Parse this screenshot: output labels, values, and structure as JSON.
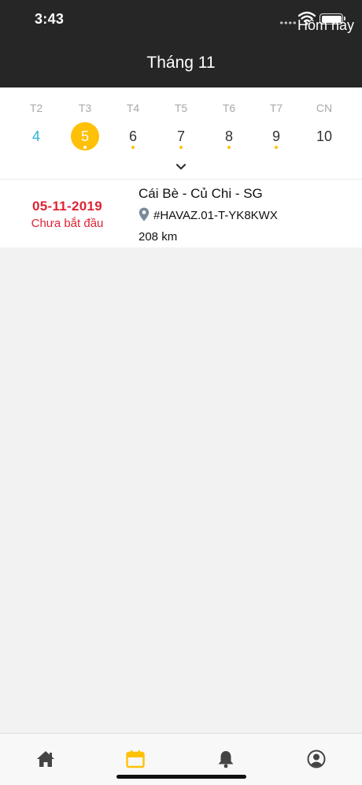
{
  "status_bar": {
    "time": "3:43"
  },
  "header": {
    "title": "Tháng 11",
    "today_label": "Hôm nay"
  },
  "calendar": {
    "days": [
      {
        "name": "T2",
        "date": "4"
      },
      {
        "name": "T3",
        "date": "5"
      },
      {
        "name": "T4",
        "date": "6"
      },
      {
        "name": "T5",
        "date": "7"
      },
      {
        "name": "T6",
        "date": "8"
      },
      {
        "name": "T7",
        "date": "9"
      },
      {
        "name": "CN",
        "date": "10"
      }
    ]
  },
  "trips": [
    {
      "date": "05-11-2019",
      "status": "Chưa bắt đầu",
      "route": "Cái Bè - Củ Chi - SG",
      "code": "#HAVAZ.01-T-YK8KWX",
      "distance": "208 km"
    }
  ],
  "tabbar": {
    "tabs": [
      {
        "icon": "home-icon"
      },
      {
        "icon": "calendar-icon"
      },
      {
        "icon": "bell-icon"
      },
      {
        "icon": "user-icon"
      }
    ]
  },
  "colors": {
    "accent": "#ffc107",
    "today": "#29b6d8",
    "danger": "#dd2435",
    "header_bg": "#262626"
  }
}
